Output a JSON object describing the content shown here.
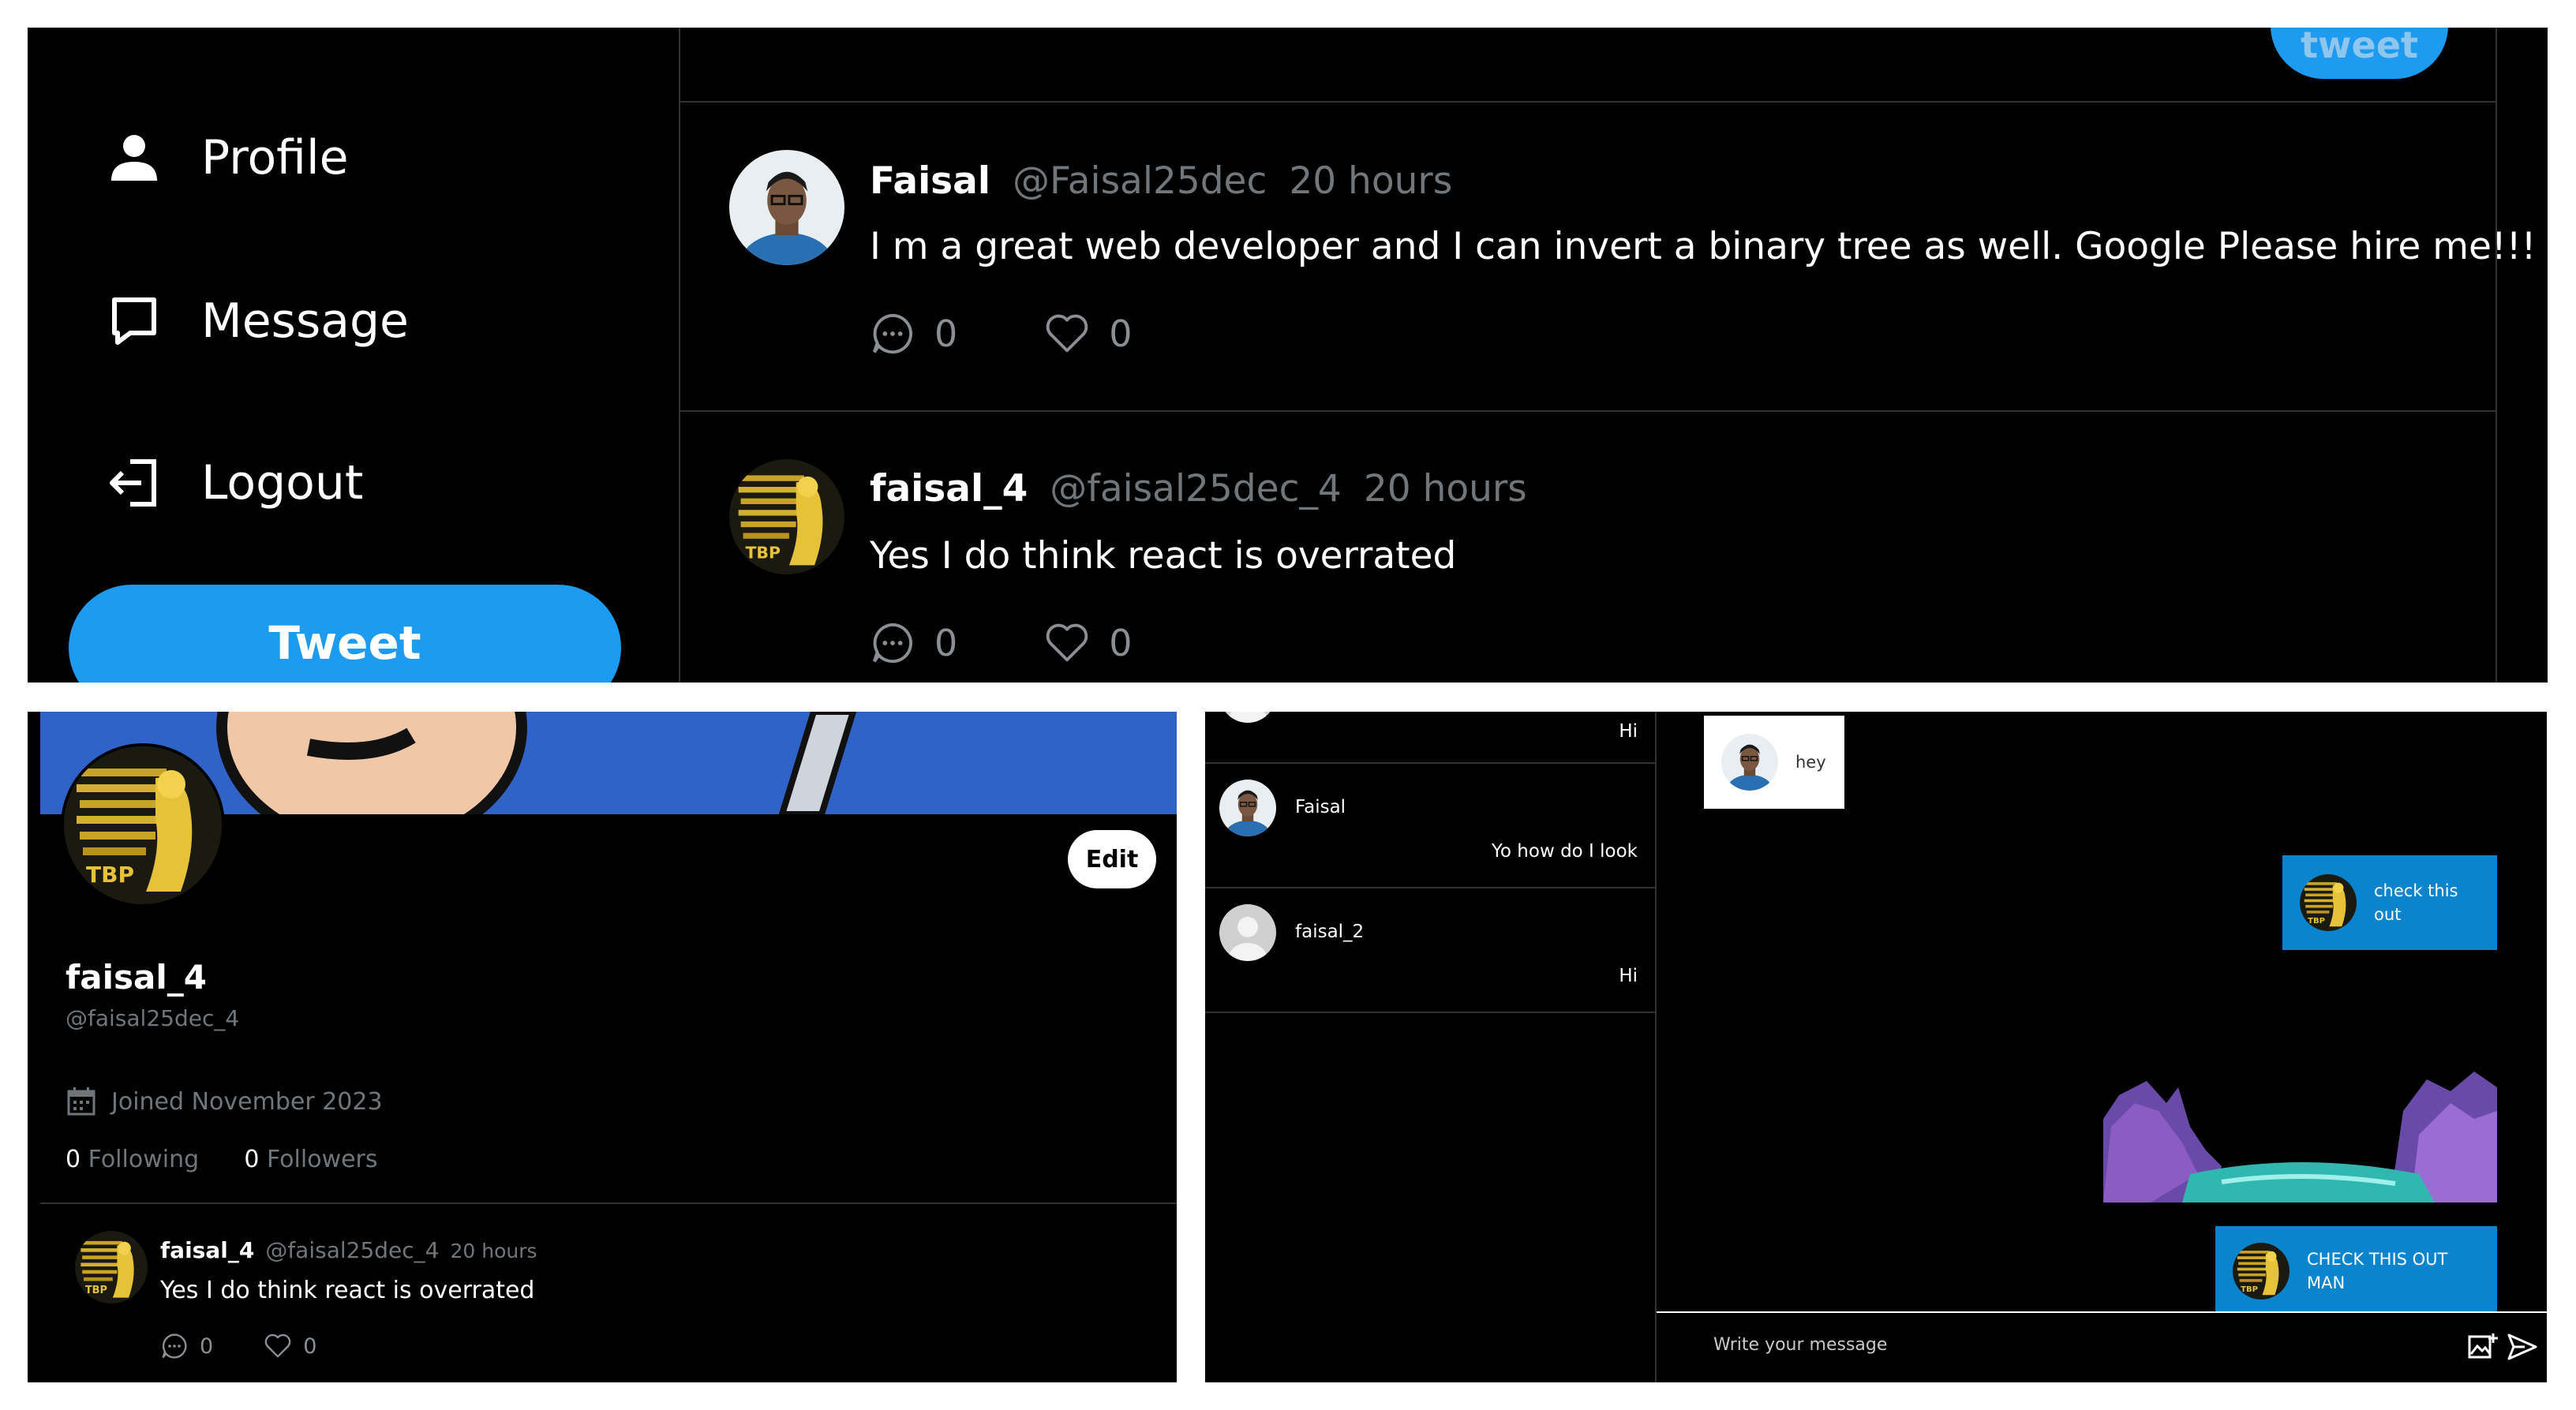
{
  "sidebar": {
    "items": [
      {
        "label": "Profile",
        "icon": "person-icon"
      },
      {
        "label": "Message",
        "icon": "message-icon"
      },
      {
        "label": "Logout",
        "icon": "logout-icon"
      }
    ],
    "tweet_button": "Tweet"
  },
  "feed": {
    "compose_button": "tweet",
    "posts": [
      {
        "name": "Faisal",
        "handle": "@Faisal25dec",
        "time": "20 hours",
        "text": "I m a great web developer and I can invert a binary tree as well. Google Please hire me!!!",
        "comments": "0",
        "likes": "0"
      },
      {
        "name": "faisal_4",
        "handle": "@faisal25dec_4",
        "time": "20 hours",
        "text": "Yes I do think react is overrated",
        "comments": "0",
        "likes": "0"
      }
    ]
  },
  "profile": {
    "edit_button": "Edit",
    "name": "faisal_4",
    "handle": "@faisal25dec_4",
    "joined": "Joined November 2023",
    "following_count": "0",
    "following_label": "Following",
    "followers_count": "0",
    "followers_label": "Followers",
    "post": {
      "name": "faisal_4",
      "handle": "@faisal25dec_4",
      "time": "20 hours",
      "text": "Yes I do think react is overrated",
      "comments": "0",
      "likes": "0"
    }
  },
  "messages": {
    "conversations": [
      {
        "name": "",
        "last": "Hi"
      },
      {
        "name": "Faisal",
        "last": "Yo how do I look"
      },
      {
        "name": "faisal_2",
        "last": "Hi"
      }
    ],
    "chat": [
      {
        "from": "other",
        "text": "hey"
      },
      {
        "from": "me",
        "text": "check this out"
      },
      {
        "from": "me",
        "type": "image"
      },
      {
        "from": "me",
        "text": "CHECK THIS OUT MAN"
      }
    ],
    "input_placeholder": "Write your message"
  },
  "colors": {
    "accent": "#1d9bf0",
    "bubble_out": "#0a84cc",
    "muted_text": "#71767b",
    "divider": "#2f3336"
  }
}
